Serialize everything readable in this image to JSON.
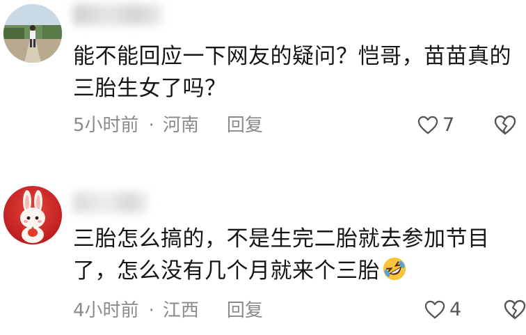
{
  "comments": [
    {
      "text": "能不能回应一下网友的疑问？恺哥，苗苗真的三胎生女了吗？",
      "time": "5小时前",
      "separator": "·",
      "location": "河南",
      "reply_label": "回复",
      "likes": "7",
      "avatar_icon": "person-photo-avatar",
      "username_blurred": true
    },
    {
      "text": "三胎怎么搞的，不是生完二胎就去参加节目了，怎么没有几个月就来个三胎",
      "emoji": "rolling-on-floor-laughing-emoji",
      "time": "4小时前",
      "separator": "·",
      "location": "江西",
      "reply_label": "回复",
      "likes": "4",
      "avatar_icon": "bunny-avatar",
      "username_blurred": true
    }
  ],
  "colors": {
    "text": "#151515",
    "meta": "#8a8a8a",
    "icon": "#555555",
    "background": "#ffffff"
  }
}
